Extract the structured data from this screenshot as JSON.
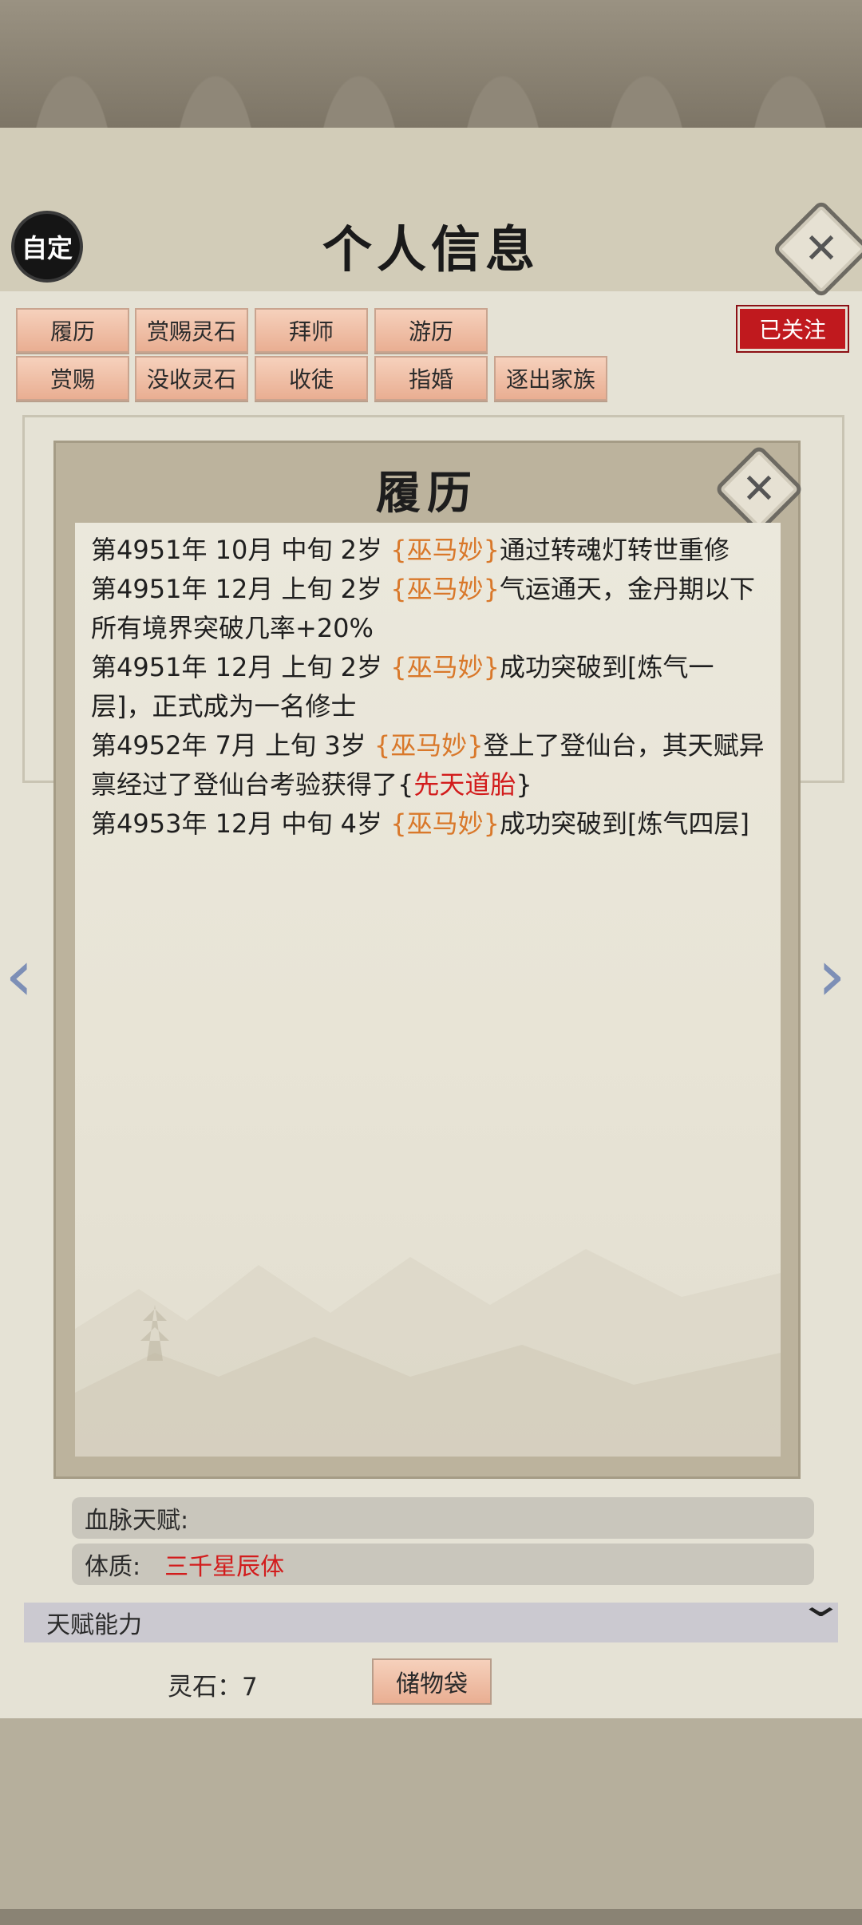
{
  "header": {
    "badge": "自定",
    "title": "个人信息"
  },
  "actions": {
    "row1": [
      "履历",
      "赏赐灵石",
      "拜师",
      "游历"
    ],
    "row2": [
      "赏赐",
      "没收灵石",
      "收徒",
      "指婚",
      "逐出家族"
    ],
    "follow": "已关注"
  },
  "modal": {
    "title": "履历",
    "entries": [
      {
        "prefix": "第4951年 10月 中旬 2岁 ",
        "name": "{巫马妙}",
        "text": "通过转魂灯转世重修",
        "talent": "",
        "suffix": ""
      },
      {
        "prefix": "第4951年 12月 上旬 2岁 ",
        "name": "{巫马妙}",
        "text": "气运通天，金丹期以下所有境界突破几率+20%",
        "talent": "",
        "suffix": ""
      },
      {
        "prefix": "第4951年 12月 上旬  2岁  ",
        "name": "{巫马妙}",
        "text": "成功突破到[炼气一层]，正式成为一名修士",
        "talent": "",
        "suffix": ""
      },
      {
        "prefix": "第4952年 7月 上旬  3岁  ",
        "name": "{巫马妙}",
        "text": "登上了登仙台，其天赋异禀经过了登仙台考验获得了{",
        "talent": "先天道胎",
        "suffix": "}"
      },
      {
        "prefix": "第4953年 12月 中旬  4岁  ",
        "name": "{巫马妙}",
        "text": "成功突破到[炼气四层]",
        "talent": "",
        "suffix": ""
      }
    ]
  },
  "details": {
    "bloodline_label": "血脉天赋:",
    "constitution_label": "体质:",
    "constitution_value": "三千星辰体",
    "section_title": "天赋能力"
  },
  "footer": {
    "stones": "灵石：7",
    "bag": "储物袋"
  },
  "colors": {
    "accent_orange": "#d9782a",
    "accent_red": "#d21c1c",
    "follow_red": "#c0191e",
    "button_peach": "#f0c0a6"
  }
}
